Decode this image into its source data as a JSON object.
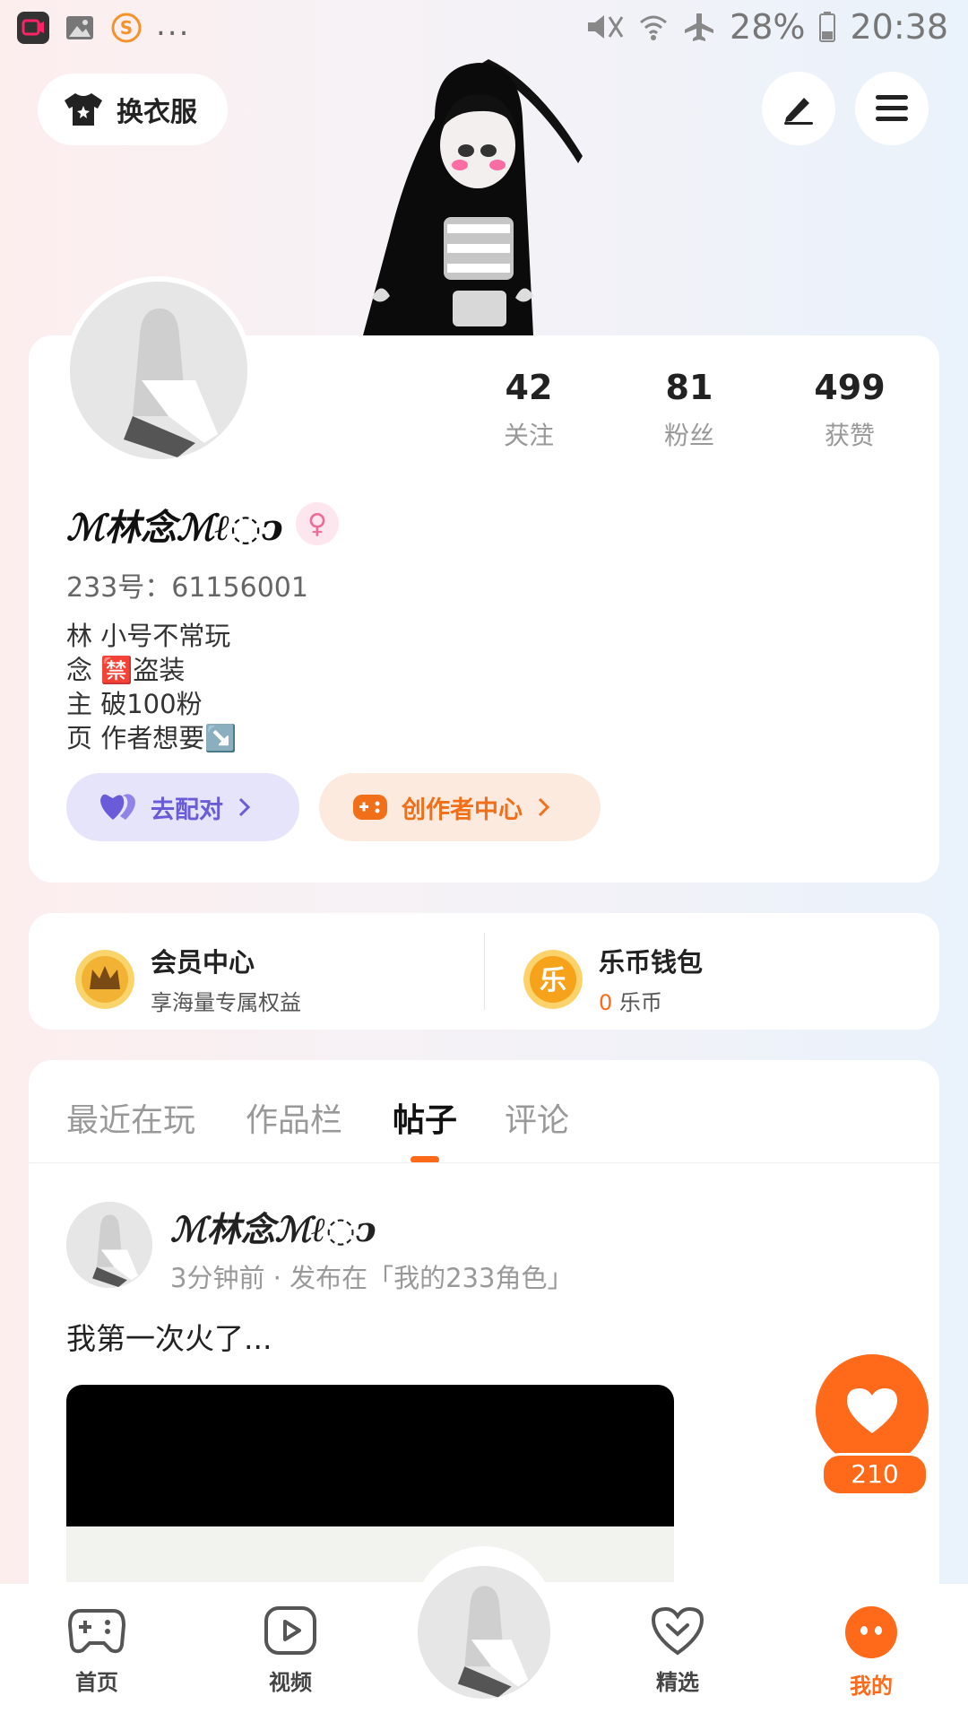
{
  "status_bar": {
    "battery": "28%",
    "time": "20:38",
    "more": "..."
  },
  "top_bar": {
    "outfit_label": "换衣服"
  },
  "profile": {
    "stats": [
      {
        "value": "42",
        "label": "关注"
      },
      {
        "value": "81",
        "label": "粉丝"
      },
      {
        "value": "499",
        "label": "获赞"
      }
    ],
    "username": "ℳ林念ℳℓ◌ↄ",
    "gender_symbol": "♀",
    "user_id": "233号：61156001",
    "bio": [
      "林 小号不常玩",
      "念 🈲盗装",
      "主 破100粉",
      "页 作者想要↘️"
    ],
    "pair_button": "去配对",
    "creator_button": "创作者中心"
  },
  "member": {
    "title": "会员中心",
    "subtitle": "享海量专属权益"
  },
  "wallet": {
    "title": "乐币钱包",
    "balance": "0",
    "unit": "乐币",
    "coin_char": "乐"
  },
  "tabs": [
    {
      "label": "最近在玩"
    },
    {
      "label": "作品栏"
    },
    {
      "label": "帖子"
    },
    {
      "label": "评论"
    }
  ],
  "post": {
    "author": "ℳ林念ℳℓ◌ↄ",
    "meta": "3分钟前 · 发布在「我的233角色」",
    "text": "我第一次火了..."
  },
  "like": {
    "count": "210"
  },
  "bottom_nav": [
    {
      "label": "首页"
    },
    {
      "label": "视频"
    },
    {
      "label": "精选"
    },
    {
      "label": "我的"
    }
  ],
  "colors": {
    "accent": "#ff6a1a",
    "pair": "#6a5bd8",
    "gold": "#f2b233"
  }
}
